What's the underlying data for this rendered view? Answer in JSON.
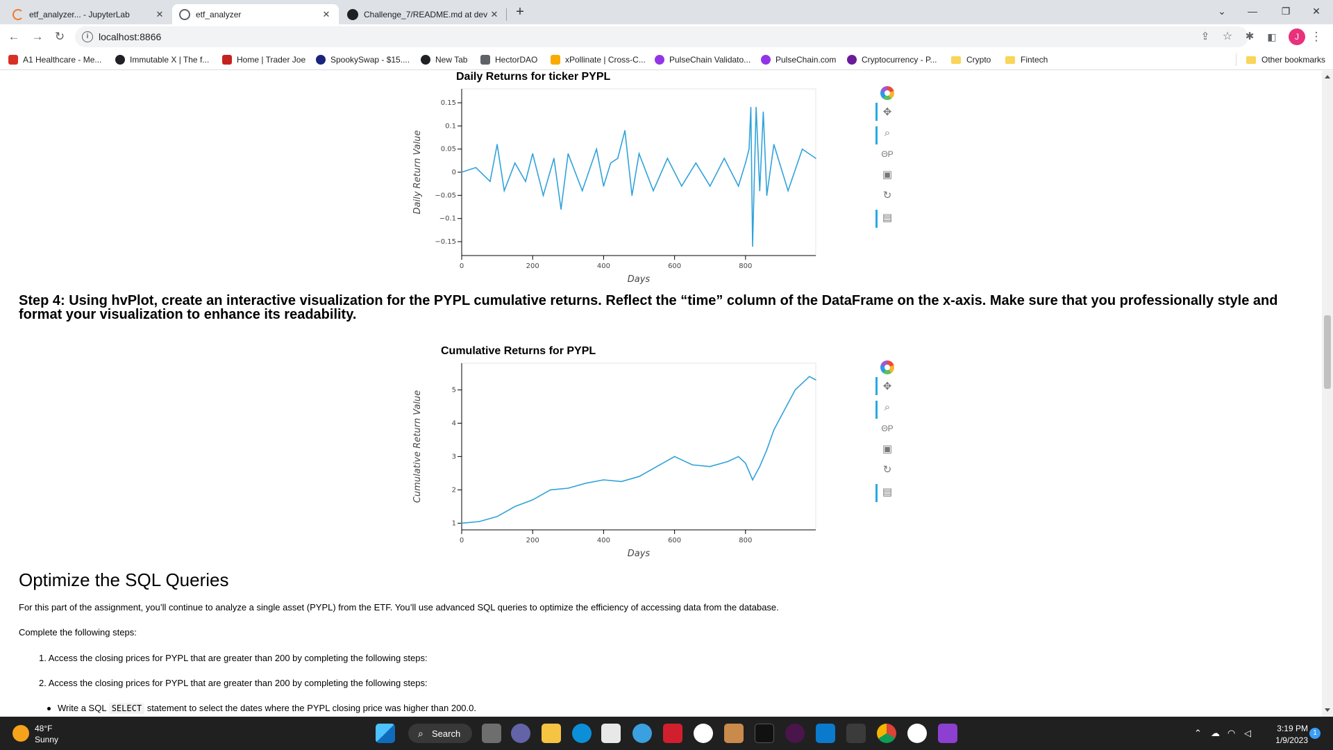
{
  "browser": {
    "tabs": [
      {
        "title": "etf_analyzer... - JupyterLab",
        "active": false,
        "icon": "jupyter-icon",
        "color": "#f37726"
      },
      {
        "title": "etf_analyzer",
        "active": true,
        "icon": "globe-icon",
        "color": "#5f6368"
      },
      {
        "title": "Challenge_7/README.md at dev",
        "active": false,
        "icon": "github-icon",
        "color": "#202124"
      }
    ],
    "close_glyph": "✕",
    "new_tab_glyph": "+",
    "url": "localhost:8866",
    "avatar_letter": "J",
    "bookmarks": [
      {
        "label": "A1 Healthcare - Me...",
        "color": "#d93025"
      },
      {
        "label": "Immutable X | The f...",
        "color": "#202124"
      },
      {
        "label": "Home | Trader Joe",
        "color": "#c5221f"
      },
      {
        "label": "SpookySwap - $15....",
        "color": "#1a237e"
      },
      {
        "label": "New Tab",
        "color": "#202124"
      },
      {
        "label": "HectorDAO",
        "color": "#5f6368"
      },
      {
        "label": "xPollinate | Cross-C...",
        "color": "#f9ab00"
      },
      {
        "label": "PulseChain Validato...",
        "color": "#9334e6"
      },
      {
        "label": "PulseChain.com",
        "color": "#9334e6"
      },
      {
        "label": "Cryptocurrency - P...",
        "color": "#6a1b9a"
      }
    ],
    "folders": [
      "Crypto",
      "Fintech"
    ],
    "other_bookmarks": "Other bookmarks"
  },
  "page": {
    "step4_heading": "Step 4: Using hvPlot, create an interactive visualization for the PYPL cumulative returns. Reflect the “time” column of the DataFrame on the x-axis. Make sure that you professionally style and format your visualization to enhance its readability.",
    "section_heading": "Optimize the SQL Queries",
    "intro_paragraph": "For this part of the assignment, you’ll continue to analyze a single asset (PYPL) from the ETF. You’ll use advanced SQL queries to optimize the efficiency of accessing data from the database.",
    "steps_intro": "Complete the following steps:",
    "list_items": [
      "1. Access the closing prices for PYPL that are greater than 200 by completing the following steps:",
      "2. Access the closing prices for PYPL that are greater than 200 by completing the following steps:"
    ],
    "bullet": {
      "pre": "Write a SQL",
      "code": "SELECT",
      "post": "statement to select the dates where the PYPL closing price was higher than 200.0."
    }
  },
  "chart_data": [
    {
      "type": "line",
      "title": "Daily Returns for ticker PYPL",
      "xlabel": "Days",
      "ylabel": "Daily Return Value",
      "xlim": [
        0,
        998
      ],
      "ylim": [
        -0.18,
        0.18
      ],
      "x_ticks": [
        "0",
        "200",
        "400",
        "600",
        "800"
      ],
      "y_ticks": [
        "0.15",
        "0.1",
        "0.05",
        "0",
        "−0.05",
        "−0.1",
        "−0.15"
      ],
      "x": [
        0,
        40,
        80,
        100,
        120,
        150,
        180,
        200,
        230,
        260,
        280,
        300,
        340,
        380,
        400,
        420,
        440,
        460,
        480,
        500,
        540,
        580,
        620,
        660,
        700,
        740,
        780,
        800,
        810,
        815,
        820,
        830,
        840,
        850,
        860,
        880,
        920,
        960,
        998
      ],
      "series": [
        {
          "values": [
            0.0,
            0.01,
            -0.02,
            0.06,
            -0.04,
            0.02,
            -0.02,
            0.04,
            -0.05,
            0.03,
            -0.08,
            0.04,
            -0.04,
            0.05,
            -0.03,
            0.02,
            0.03,
            0.09,
            -0.05,
            0.04,
            -0.04,
            0.03,
            -0.03,
            0.02,
            -0.03,
            0.03,
            -0.03,
            0.02,
            0.05,
            0.14,
            -0.16,
            0.14,
            -0.04,
            0.13,
            -0.05,
            0.06,
            -0.04,
            0.05,
            0.03
          ]
        }
      ],
      "line_color": "#30a2da",
      "grid": false,
      "toolbar_position": "right"
    },
    {
      "type": "line",
      "title": "Cumulative Returns for PYPL",
      "xlabel": "Days",
      "ylabel": "Cumulative Return Value",
      "xlim": [
        0,
        998
      ],
      "ylim": [
        0.8,
        5.8
      ],
      "x_ticks": [
        "0",
        "200",
        "400",
        "600",
        "800"
      ],
      "y_ticks": [
        "1",
        "2",
        "3",
        "4",
        "5"
      ],
      "x": [
        0,
        50,
        100,
        150,
        200,
        250,
        300,
        350,
        400,
        450,
        500,
        550,
        600,
        650,
        700,
        750,
        780,
        800,
        820,
        840,
        860,
        880,
        900,
        920,
        940,
        960,
        980,
        998
      ],
      "series": [
        {
          "values": [
            1.0,
            1.05,
            1.2,
            1.5,
            1.7,
            2.0,
            2.05,
            2.2,
            2.3,
            2.25,
            2.4,
            2.7,
            3.0,
            2.75,
            2.7,
            2.85,
            3.0,
            2.8,
            2.3,
            2.7,
            3.2,
            3.8,
            4.2,
            4.6,
            5.0,
            5.2,
            5.4,
            5.3
          ]
        }
      ],
      "line_color": "#30a2da",
      "grid": false,
      "toolbar_position": "right"
    }
  ],
  "taskbar": {
    "temperature": "48°F",
    "condition": "Sunny",
    "search_label": "Search",
    "time": "3:19 PM",
    "date": "1/9/2023",
    "notification_count": "1"
  }
}
